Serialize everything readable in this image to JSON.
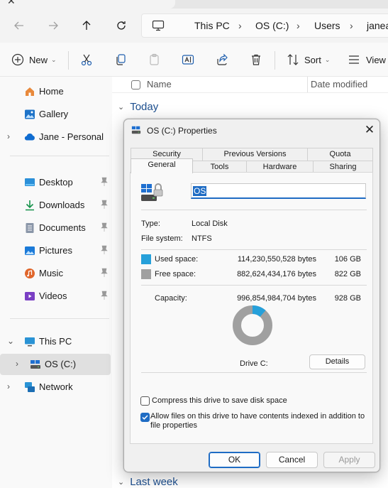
{
  "window": {
    "title": "OS (C:)"
  },
  "address": {
    "crumbs": [
      "This PC",
      "OS (C:)",
      "Users",
      "janea"
    ]
  },
  "toolbar": {
    "new_label": "New",
    "sort_label": "Sort",
    "view_label": "View"
  },
  "sidebar": {
    "home": "Home",
    "gallery": "Gallery",
    "personal": "Jane - Personal",
    "desktop": "Desktop",
    "downloads": "Downloads",
    "documents": "Documents",
    "pictures": "Pictures",
    "music": "Music",
    "videos": "Videos",
    "thispc": "This PC",
    "osc": "OS (C:)",
    "network": "Network"
  },
  "list": {
    "col_name": "Name",
    "col_date": "Date modified",
    "group_today": "Today",
    "group_lastweek": "Last week"
  },
  "dialog": {
    "title": "OS (C:) Properties",
    "tabs_back": [
      "Security",
      "Previous Versions",
      "Quota"
    ],
    "tabs_front": [
      "General",
      "Tools",
      "Hardware",
      "Sharing"
    ],
    "volume_label": "OS",
    "type_label": "Type:",
    "type_value": "Local Disk",
    "fs_label": "File system:",
    "fs_value": "NTFS",
    "used_label": "Used space:",
    "used_bytes": "114,230,550,528 bytes",
    "used_gb": "106 GB",
    "free_label": "Free space:",
    "free_bytes": "882,624,434,176 bytes",
    "free_gb": "822 GB",
    "capacity_label": "Capacity:",
    "capacity_bytes": "996,854,984,704 bytes",
    "capacity_gb": "928 GB",
    "drive_label": "Drive C:",
    "details_button": "Details",
    "compress_label": "Compress this drive to save disk space",
    "compress_checked": false,
    "index_label_line1": "Allow files on this drive to have contents indexed in addition to",
    "index_label_line2": "file properties",
    "index_checked": true,
    "ok_button": "OK",
    "cancel_button": "Cancel",
    "apply_button": "Apply",
    "used_fraction": 0.1146,
    "used_color": "#26a0da",
    "free_color": "#a0a0a0"
  }
}
